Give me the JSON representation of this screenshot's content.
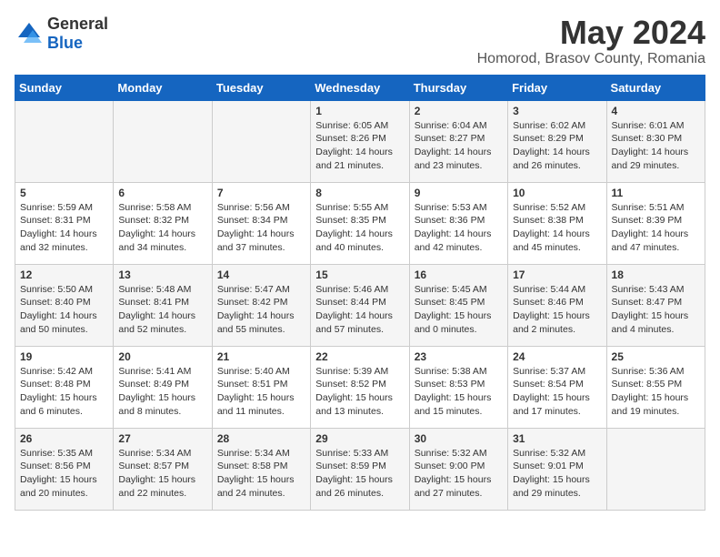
{
  "logo": {
    "general": "General",
    "blue": "Blue"
  },
  "title": "May 2024",
  "subtitle": "Homorod, Brasov County, Romania",
  "days_of_week": [
    "Sunday",
    "Monday",
    "Tuesday",
    "Wednesday",
    "Thursday",
    "Friday",
    "Saturday"
  ],
  "weeks": [
    [
      {
        "day": "",
        "info": ""
      },
      {
        "day": "",
        "info": ""
      },
      {
        "day": "",
        "info": ""
      },
      {
        "day": "1",
        "info": "Sunrise: 6:05 AM\nSunset: 8:26 PM\nDaylight: 14 hours\nand 21 minutes."
      },
      {
        "day": "2",
        "info": "Sunrise: 6:04 AM\nSunset: 8:27 PM\nDaylight: 14 hours\nand 23 minutes."
      },
      {
        "day": "3",
        "info": "Sunrise: 6:02 AM\nSunset: 8:29 PM\nDaylight: 14 hours\nand 26 minutes."
      },
      {
        "day": "4",
        "info": "Sunrise: 6:01 AM\nSunset: 8:30 PM\nDaylight: 14 hours\nand 29 minutes."
      }
    ],
    [
      {
        "day": "5",
        "info": "Sunrise: 5:59 AM\nSunset: 8:31 PM\nDaylight: 14 hours\nand 32 minutes."
      },
      {
        "day": "6",
        "info": "Sunrise: 5:58 AM\nSunset: 8:32 PM\nDaylight: 14 hours\nand 34 minutes."
      },
      {
        "day": "7",
        "info": "Sunrise: 5:56 AM\nSunset: 8:34 PM\nDaylight: 14 hours\nand 37 minutes."
      },
      {
        "day": "8",
        "info": "Sunrise: 5:55 AM\nSunset: 8:35 PM\nDaylight: 14 hours\nand 40 minutes."
      },
      {
        "day": "9",
        "info": "Sunrise: 5:53 AM\nSunset: 8:36 PM\nDaylight: 14 hours\nand 42 minutes."
      },
      {
        "day": "10",
        "info": "Sunrise: 5:52 AM\nSunset: 8:38 PM\nDaylight: 14 hours\nand 45 minutes."
      },
      {
        "day": "11",
        "info": "Sunrise: 5:51 AM\nSunset: 8:39 PM\nDaylight: 14 hours\nand 47 minutes."
      }
    ],
    [
      {
        "day": "12",
        "info": "Sunrise: 5:50 AM\nSunset: 8:40 PM\nDaylight: 14 hours\nand 50 minutes."
      },
      {
        "day": "13",
        "info": "Sunrise: 5:48 AM\nSunset: 8:41 PM\nDaylight: 14 hours\nand 52 minutes."
      },
      {
        "day": "14",
        "info": "Sunrise: 5:47 AM\nSunset: 8:42 PM\nDaylight: 14 hours\nand 55 minutes."
      },
      {
        "day": "15",
        "info": "Sunrise: 5:46 AM\nSunset: 8:44 PM\nDaylight: 14 hours\nand 57 minutes."
      },
      {
        "day": "16",
        "info": "Sunrise: 5:45 AM\nSunset: 8:45 PM\nDaylight: 15 hours\nand 0 minutes."
      },
      {
        "day": "17",
        "info": "Sunrise: 5:44 AM\nSunset: 8:46 PM\nDaylight: 15 hours\nand 2 minutes."
      },
      {
        "day": "18",
        "info": "Sunrise: 5:43 AM\nSunset: 8:47 PM\nDaylight: 15 hours\nand 4 minutes."
      }
    ],
    [
      {
        "day": "19",
        "info": "Sunrise: 5:42 AM\nSunset: 8:48 PM\nDaylight: 15 hours\nand 6 minutes."
      },
      {
        "day": "20",
        "info": "Sunrise: 5:41 AM\nSunset: 8:49 PM\nDaylight: 15 hours\nand 8 minutes."
      },
      {
        "day": "21",
        "info": "Sunrise: 5:40 AM\nSunset: 8:51 PM\nDaylight: 15 hours\nand 11 minutes."
      },
      {
        "day": "22",
        "info": "Sunrise: 5:39 AM\nSunset: 8:52 PM\nDaylight: 15 hours\nand 13 minutes."
      },
      {
        "day": "23",
        "info": "Sunrise: 5:38 AM\nSunset: 8:53 PM\nDaylight: 15 hours\nand 15 minutes."
      },
      {
        "day": "24",
        "info": "Sunrise: 5:37 AM\nSunset: 8:54 PM\nDaylight: 15 hours\nand 17 minutes."
      },
      {
        "day": "25",
        "info": "Sunrise: 5:36 AM\nSunset: 8:55 PM\nDaylight: 15 hours\nand 19 minutes."
      }
    ],
    [
      {
        "day": "26",
        "info": "Sunrise: 5:35 AM\nSunset: 8:56 PM\nDaylight: 15 hours\nand 20 minutes."
      },
      {
        "day": "27",
        "info": "Sunrise: 5:34 AM\nSunset: 8:57 PM\nDaylight: 15 hours\nand 22 minutes."
      },
      {
        "day": "28",
        "info": "Sunrise: 5:34 AM\nSunset: 8:58 PM\nDaylight: 15 hours\nand 24 minutes."
      },
      {
        "day": "29",
        "info": "Sunrise: 5:33 AM\nSunset: 8:59 PM\nDaylight: 15 hours\nand 26 minutes."
      },
      {
        "day": "30",
        "info": "Sunrise: 5:32 AM\nSunset: 9:00 PM\nDaylight: 15 hours\nand 27 minutes."
      },
      {
        "day": "31",
        "info": "Sunrise: 5:32 AM\nSunset: 9:01 PM\nDaylight: 15 hours\nand 29 minutes."
      },
      {
        "day": "",
        "info": ""
      }
    ]
  ]
}
